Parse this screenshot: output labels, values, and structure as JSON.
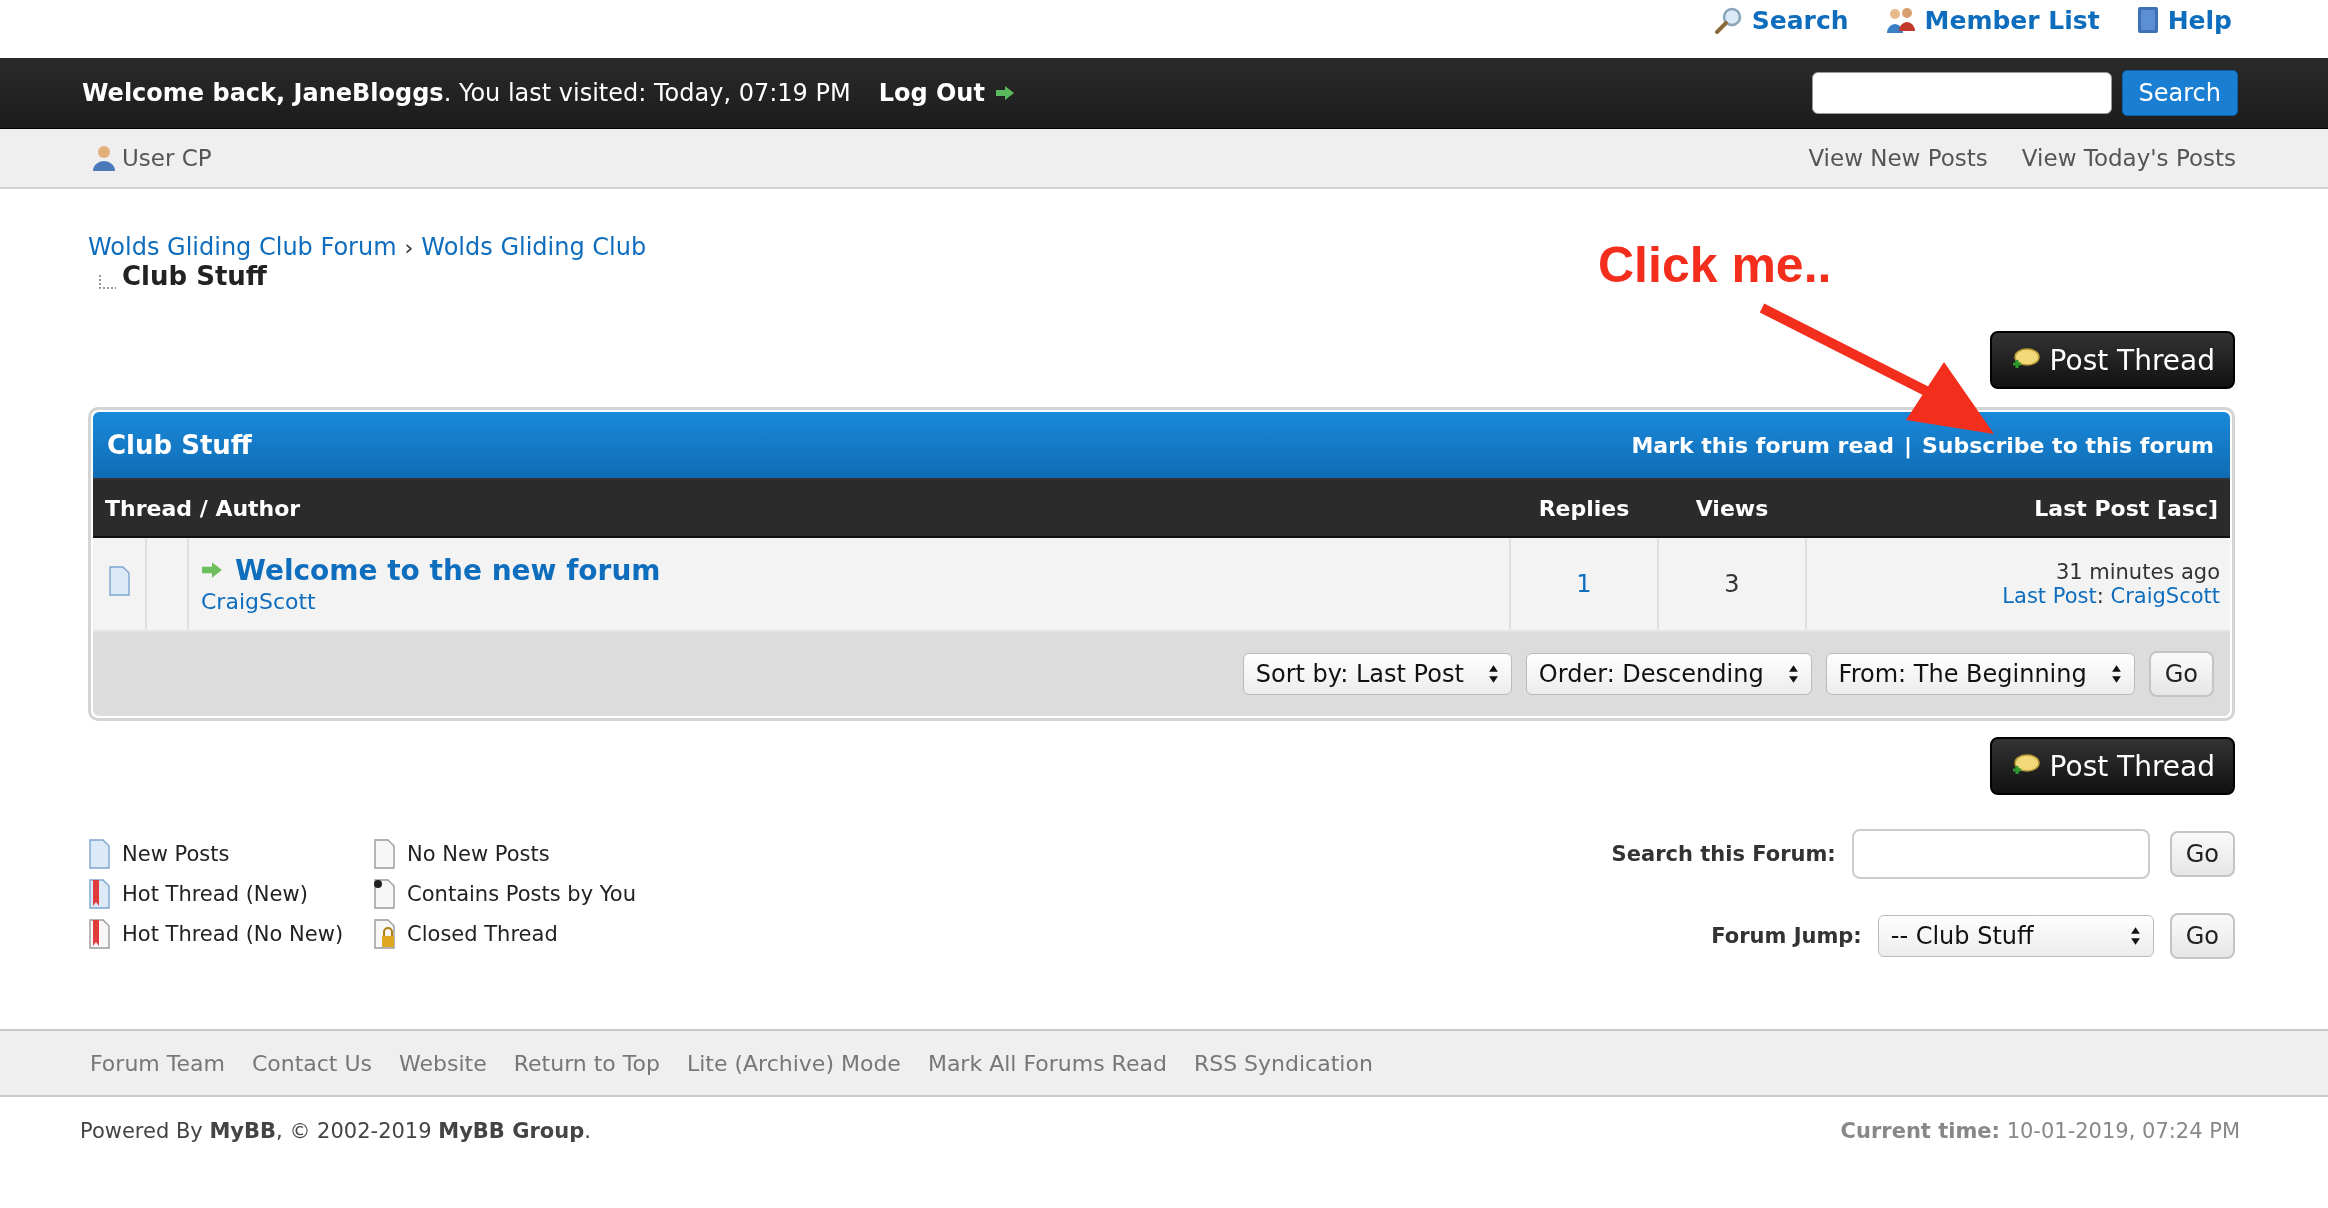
{
  "top_links": [
    {
      "label": "Search",
      "kind": "search"
    },
    {
      "label": "Member List",
      "kind": "members"
    },
    {
      "label": "Help",
      "kind": "help"
    }
  ],
  "welcome_bar": {
    "text": "**Welcome back, JaneBloggs**. You last visited: Today, 07:19 PM",
    "logout": "Log Out",
    "search_button": "Search"
  },
  "nav_bar": {
    "user_cp": "User CP",
    "links": [
      "View New Posts",
      "View Today's Posts"
    ]
  },
  "breadcrumb": {
    "links": [
      "Wolds Gliding Club Forum",
      "Wolds Gliding Club"
    ],
    "separator": "›",
    "current": "Club Stuff"
  },
  "annotation": {
    "text": "Click me.."
  },
  "post_thread_buttons": [
    "Post Thread",
    "Post Thread"
  ],
  "forum": {
    "title": "Club Stuff",
    "actions": [
      "Mark this forum read",
      "Subscribe to this forum"
    ],
    "action_separator": "|",
    "columns": [
      "Thread / Author",
      "Replies",
      "Views",
      "Last Post [asc]"
    ],
    "threads": [
      {
        "title": "Welcome to the new forum",
        "author": "CraigScott",
        "replies": "1",
        "views": "3",
        "last_post_time": "31 minutes ago",
        "last_post_label": "Last Post",
        "last_post_separator": ":",
        "last_post_author": "CraigScott"
      }
    ],
    "sort_selects": [
      "Sort by: Last Post",
      "Order: Descending",
      "From: The Beginning"
    ],
    "go": "Go"
  },
  "legend": [
    {
      "label": "New Posts",
      "kind": "new"
    },
    {
      "label": "No New Posts",
      "kind": "plain"
    },
    {
      "label": "Hot Thread (New)",
      "kind": "hot_new"
    },
    {
      "label": "Contains Posts by You",
      "kind": "dot"
    },
    {
      "label": "Hot Thread (No New)",
      "kind": "hot"
    },
    {
      "label": "Closed Thread",
      "kind": "closed"
    }
  ],
  "search_forum": {
    "label": "Search this Forum:",
    "button": "Go"
  },
  "forum_jump": {
    "label": "Forum Jump:",
    "value": "-- Club Stuff",
    "button": "Go"
  },
  "footer_links": [
    "Forum Team",
    "Contact Us",
    "Website",
    "Return to Top",
    "Lite (Archive) Mode",
    "Mark All Forums Read",
    "RSS Syndication"
  ],
  "powered": "Powered By **MyBB**, © 2002-2019 **MyBB Group**.",
  "current_time": "**Current time:** 10-01-2019, 07:24 PM"
}
